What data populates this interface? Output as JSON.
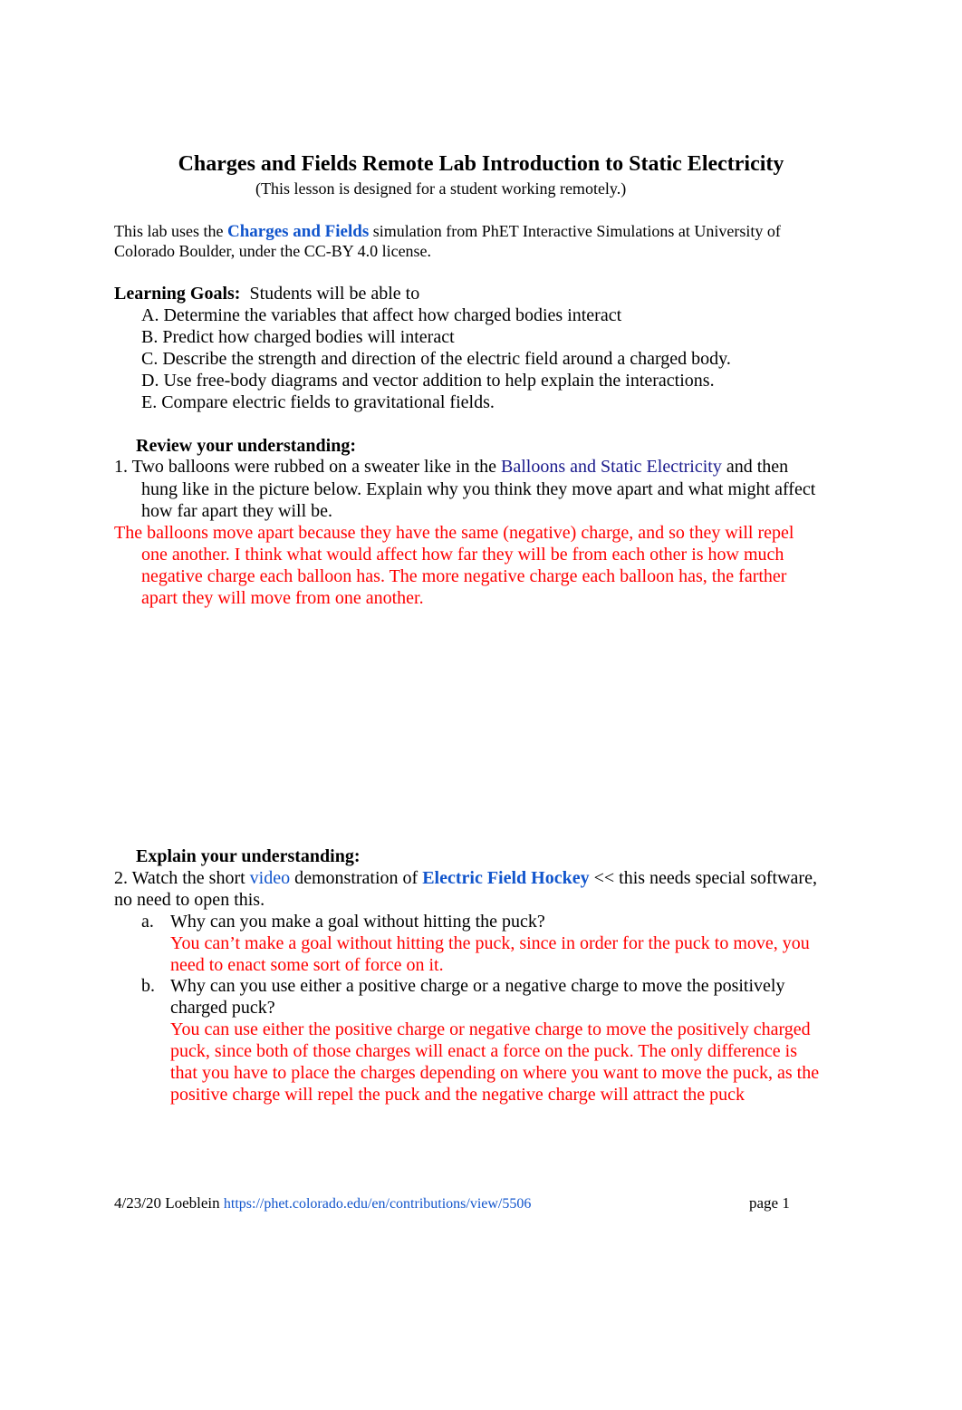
{
  "document": {
    "title": "Charges and Fields Remote Lab Introduction to Static Electricity",
    "subtitle": "(This lesson is designed for a student working remotely.)",
    "intro": {
      "prefix": "This lab uses the ",
      "link": "Charges and Fields",
      "line1_suffix": " simulation from PhET Interactive Simulations at University of",
      "line2": "Colorado Boulder, under the CC-BY 4.0 license."
    },
    "learning_goals": {
      "label": "Learning Goals:",
      "lead": "Students will be able to",
      "items": [
        "A. Determine the variables that affect how charged bodies interact",
        "B. Predict how charged bodies will interact",
        "C. Describe the strength and direction of the electric field around a charged body.",
        "D. Use free-body diagrams and vector addition to help explain the interactions.",
        "E. Compare electric fields to gravitational fields."
      ]
    },
    "review": {
      "heading": "Review your understanding:",
      "q1": {
        "prefix": "1. Two balloons were rubbed on a sweater like in the ",
        "link": "Balloons and Static Electricity",
        "suffix": " and then",
        "line2": "hung like in the picture below. Explain why you think they move apart and what might affect",
        "line3": "how far apart they will be."
      },
      "answer_lines": [
        "The balloons move apart because they have the same (negative) charge, and so they will repel",
        "one another. I think what would affect how far they will be from each other is how much",
        "negative charge each balloon has. The more negative charge each balloon has, the farther",
        "apart they will move from one another."
      ]
    },
    "explain": {
      "heading": "Explain your understanding:",
      "q2": {
        "prefix": "2. Watch the short ",
        "video_link": "video",
        "middle": " demonstration of ",
        "hockey_link": "Electric Field Hockey",
        "suffix": " << this needs special software,",
        "line2": "no need to open this."
      },
      "parts": [
        {
          "marker": "a.",
          "question_lines": [
            "Why can you make a goal without hitting the puck?"
          ],
          "answer_lines": [
            "You can’t make a goal without hitting the puck, since in order for the puck to move, you",
            "need to enact some sort of force on it."
          ]
        },
        {
          "marker": "b.",
          "question_lines": [
            "Why can you use either a positive charge or a negative charge to move the positively",
            "charged puck?"
          ],
          "answer_lines": [
            "You can use either the positive charge or negative charge to move the positively charged",
            "puck, since both of those charges will enact a force on the puck. The only difference is",
            "that you have to place the charges depending on where you want to move the puck, as the",
            "positive charge will repel the puck and the negative charge will attract the puck"
          ]
        }
      ]
    },
    "footer": {
      "date_author": "4/23/20 Loeblein ",
      "url": "https://phet.colorado.edu/en/contributions/view/5506",
      "page": "page 1"
    }
  },
  "colors": {
    "link_blue": "#1155cc",
    "link_navy": "#1a1a8c",
    "answer_red": "#ff0000",
    "text": "#000000"
  }
}
